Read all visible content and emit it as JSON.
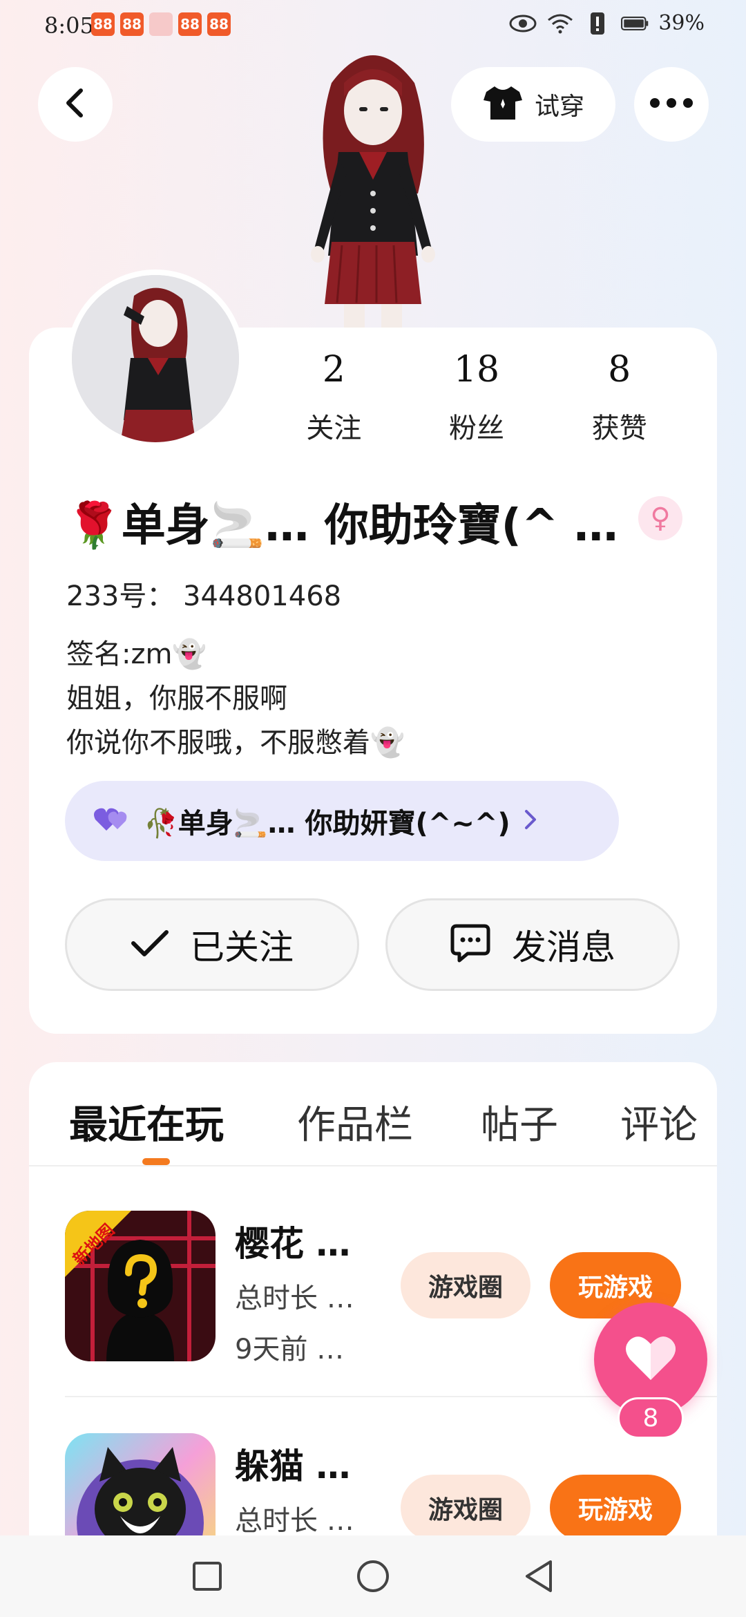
{
  "status_bar": {
    "time": "8:05",
    "notifications": [
      "app-notif-icon",
      "app-notif-icon",
      "app-notif-icon",
      "app-notif-icon",
      "app-notif-icon"
    ],
    "battery": "39%"
  },
  "header": {
    "try_on_label": "试穿"
  },
  "profile": {
    "stats": [
      {
        "value": "2",
        "label": "关注"
      },
      {
        "value": "18",
        "label": "粉丝"
      },
      {
        "value": "8",
        "label": "获赞"
      }
    ],
    "name": "🌹单身🚬… 你助玲寶(^ …",
    "gender": "♀",
    "id_line": "233号： 344801468",
    "bio": [
      "签名:zm👻",
      "姐姐，你服不服啊",
      "你说你不服哦，不服憋着👻"
    ],
    "group": {
      "name": "🥀单身🚬… 你助妍寶(^~^)"
    },
    "follow_button": "已关注",
    "message_button": "发消息"
  },
  "tabs": [
    {
      "label": "最近在玩",
      "active": true
    },
    {
      "label": "作品栏",
      "active": false
    },
    {
      "label": "帖子",
      "active": false
    },
    {
      "label": "评论",
      "active": false
    }
  ],
  "games": [
    {
      "title": "樱花 …",
      "badge": "新地图",
      "total_time": "总时长 …",
      "last_played": "9天前 …",
      "circle_label": "游戏圈",
      "play_label": "玩游戏"
    },
    {
      "title": "躲猫 …",
      "total_time": "总时长 …",
      "circle_label": "游戏圈",
      "play_label": "玩游戏"
    }
  ],
  "like_count": "8"
}
